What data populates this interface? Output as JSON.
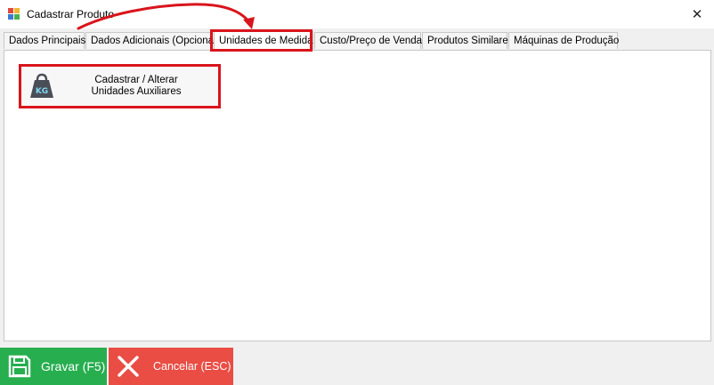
{
  "window": {
    "title": "Cadastrar Produto",
    "close_glyph": "✕"
  },
  "tabs": [
    {
      "label": "Dados Principais",
      "active": false
    },
    {
      "label": "Dados Adicionais (Opcional)",
      "active": false
    },
    {
      "label": "Unidades de Medida",
      "active": true
    },
    {
      "label": "Custo/Preço de Venda",
      "active": false
    },
    {
      "label": "Produtos Similares",
      "active": false
    },
    {
      "label": "Máquinas de Produção",
      "active": false
    }
  ],
  "main": {
    "action_button": {
      "line1": "Cadastrar / Alterar",
      "line2": "Unidades Auxiliares",
      "icon": "weight-kg-icon",
      "icon_text": "KG"
    }
  },
  "footer": {
    "save_label": "Gravar (F5)",
    "cancel_label": "Cancelar (ESC)"
  },
  "colors": {
    "highlight": "#d9141c",
    "save": "#27ae4f",
    "cancel": "#e94d44"
  }
}
